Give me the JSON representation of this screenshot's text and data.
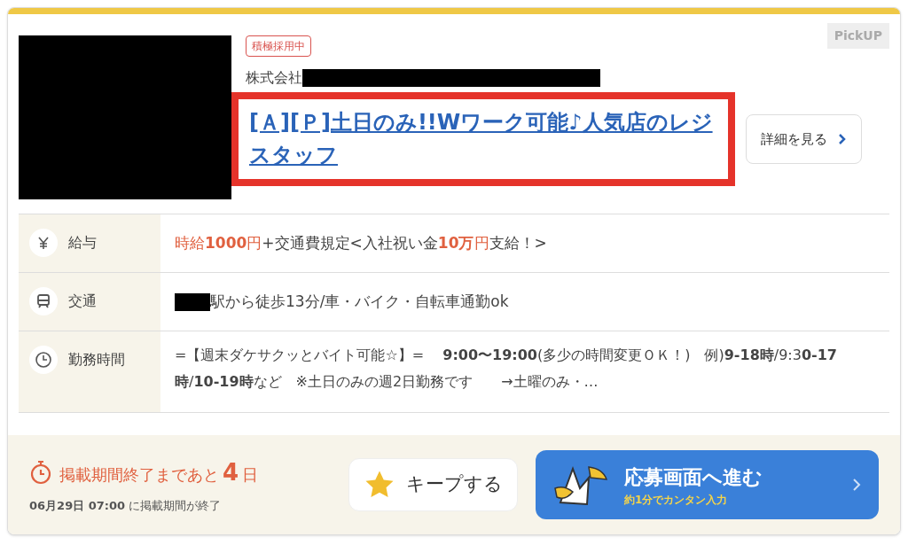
{
  "card": {
    "pickup_label": "PickUP",
    "tag": "積極採用中",
    "company": "株式会社",
    "title": "[Ａ][Ｐ]土日のみ!!Wワーク可能♪人気店のレジスタッフ",
    "title_highlighted": true,
    "details_button": "詳細を見る"
  },
  "rows": [
    {
      "kind": "salary",
      "label": "給与",
      "segments": [
        {
          "text": "時給",
          "accent": true,
          "bold": false
        },
        {
          "text": "1000",
          "accent": true,
          "bold": true
        },
        {
          "text": "円",
          "accent": true,
          "bold": false
        },
        {
          "text": "+交通費規定<入社祝い金",
          "accent": false,
          "bold": false
        },
        {
          "text": "10万",
          "accent": true,
          "bold": true
        },
        {
          "text": "円",
          "accent": true,
          "bold": false
        },
        {
          "text": "支給！>",
          "accent": false,
          "bold": false
        }
      ]
    },
    {
      "kind": "access",
      "label": "交通",
      "redacted_prefix": true,
      "text": "駅から徒歩13分/車・バイク・自転車通勤ok"
    },
    {
      "kind": "hours",
      "label": "勤務時間",
      "text": "=【週末ダケサクッとバイト可能☆】=　 **9:00〜19:00**(多少の時間変更ＯＫ！)　例)**9-18時**/9:3**0-17時**/**10-19時**など　※土日のみの週2日勤務です　　→土曜のみ・…"
    }
  ],
  "footer": {
    "deadline_prefix": "掲載期間終了まであと",
    "days": "4",
    "days_unit": "日",
    "deadline_date": "06月29日 07:00",
    "deadline_suffix": "に掲載期間が終了",
    "keep_button": "キープする",
    "kept": false,
    "apply_button": "応募画面へ進む",
    "apply_subtitle": "約1分でカンタン入力"
  }
}
